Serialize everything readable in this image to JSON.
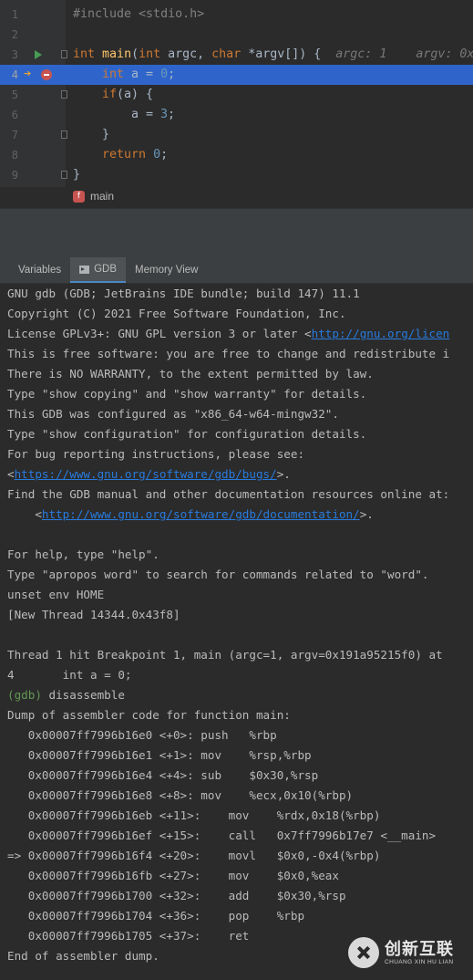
{
  "editor": {
    "lines": [
      {
        "num": "1"
      },
      {
        "num": "2"
      },
      {
        "num": "3"
      },
      {
        "num": "4"
      },
      {
        "num": "5"
      },
      {
        "num": "6"
      },
      {
        "num": "7"
      },
      {
        "num": "8"
      },
      {
        "num": "9"
      }
    ],
    "code": {
      "l1_include": "#include <stdio.h>",
      "l3_int": "int",
      "l3_main": "main",
      "l3_params_a": "(",
      "l3_int2": "int",
      "l3_params_b": " argc, ",
      "l3_char": "char",
      "l3_params_c": " *argv[]) {",
      "l3_inlay_argc": "argc: 1",
      "l3_inlay_argv": "argv: 0x",
      "l4_int": "int",
      "l4_rest": " a = ",
      "l4_num": "0",
      "l4_semi": ";",
      "l5_if": "if",
      "l5_rest": "(a) {",
      "l6_rest": "a = ",
      "l6_num": "3",
      "l6_semi": ";",
      "l7_rest": "}",
      "l8_return": "return",
      "l8_num": "0",
      "l8_semi": ";",
      "l9_rest": "}"
    },
    "breadcrumb": "main",
    "breadcrumb_badge": "f"
  },
  "tabs": {
    "variables": "Variables",
    "gdb": "GDB",
    "memory_view": "Memory View"
  },
  "console": {
    "l01": "GNU gdb (GDB; JetBrains IDE bundle; build 147) 11.1",
    "l02": "Copyright (C) 2021 Free Software Foundation, Inc.",
    "l03a": "License GPLv3+: GNU GPL version 3 or later <",
    "l03link": "http://gnu.org/licen",
    "l04": "This is free software: you are free to change and redistribute i",
    "l05": "There is NO WARRANTY, to the extent permitted by law.",
    "l06": "Type \"show copying\" and \"show warranty\" for details.",
    "l07": "This GDB was configured as \"x86_64-w64-mingw32\".",
    "l08": "Type \"show configuration\" for configuration details.",
    "l09": "For bug reporting instructions, please see:",
    "l10a": "<",
    "l10link": "https://www.gnu.org/software/gdb/bugs/",
    "l10b": ">.",
    "l11": "Find the GDB manual and other documentation resources online at:",
    "l12a": "    <",
    "l12link": "http://www.gnu.org/software/gdb/documentation/",
    "l12b": ">.",
    "l14": "For help, type \"help\".",
    "l15": "Type \"apropos word\" to search for commands related to \"word\".",
    "l16": "unset env HOME",
    "l17": "[New Thread 14344.0x43f8]",
    "l19": "Thread 1 hit Breakpoint 1, main (argc=1, argv=0x191a95215f0) at",
    "l20": "4       int a = 0;",
    "l21_prompt": "(gdb)",
    "l21_cmd": " disassemble",
    "l22": "Dump of assembler code for function main:",
    "asm": [
      "   0x00007ff7996b16e0 <+0>: push   %rbp",
      "   0x00007ff7996b16e1 <+1>: mov    %rsp,%rbp",
      "   0x00007ff7996b16e4 <+4>: sub    $0x30,%rsp",
      "   0x00007ff7996b16e8 <+8>: mov    %ecx,0x10(%rbp)",
      "   0x00007ff7996b16eb <+11>:    mov    %rdx,0x18(%rbp)",
      "   0x00007ff7996b16ef <+15>:    call   0x7ff7996b17e7 <__main>",
      "=> 0x00007ff7996b16f4 <+20>:    movl   $0x0,-0x4(%rbp)",
      "   0x00007ff7996b16fb <+27>:    mov    $0x0,%eax",
      "   0x00007ff7996b1700 <+32>:    add    $0x30,%rsp",
      "   0x00007ff7996b1704 <+36>:    pop    %rbp",
      "   0x00007ff7996b1705 <+37>:    ret"
    ],
    "end": "End of assembler dump."
  },
  "watermark": {
    "main": "创新互联",
    "sub": "CHUANG XIN HU LIAN"
  },
  "icons": {
    "run": "run-gutter-icon",
    "execution_point": "execution-point-arrow-icon",
    "breakpoint": "breakpoint-icon"
  },
  "colors": {
    "editor_bg": "#2b2b2b",
    "current_line": "#2f65ca",
    "keyword": "#cc7832",
    "number": "#6897bb",
    "link": "#287bde",
    "prompt": "#629755"
  }
}
